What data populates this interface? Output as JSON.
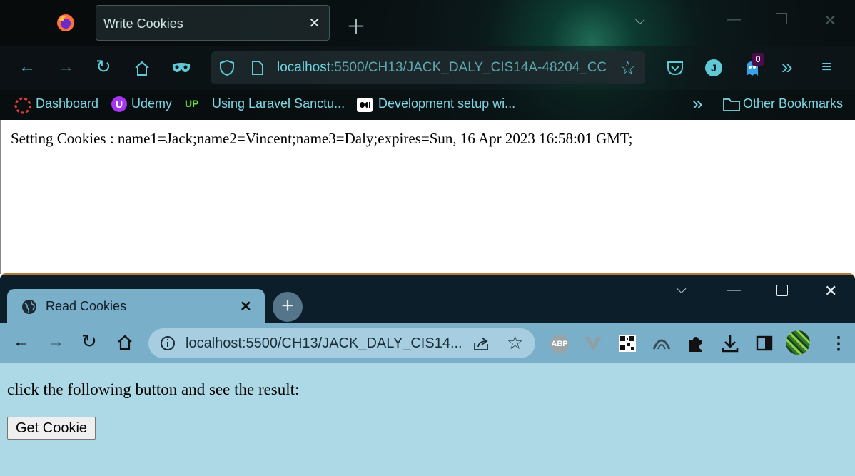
{
  "firefox": {
    "tab": {
      "title": "Write Cookies"
    },
    "url": {
      "host": "localhost",
      "path": ":5500/CH13/JACK_DALY_CIS14A-48204_CC"
    },
    "profile_initial": "J",
    "extension_badge": "0",
    "bookmarks": [
      {
        "label": "Dashboard"
      },
      {
        "label": "Udemy"
      },
      {
        "label": "UP_"
      },
      {
        "label": "Using Laravel Sanctu..."
      },
      {
        "label": "Development setup wi..."
      },
      {
        "label": "Other Bookmarks"
      }
    ],
    "content_text": "Setting Cookies : name1=Jack;name2=Vincent;name3=Daly;expires=Sun, 16 Apr 2023 16:58:01 GMT;"
  },
  "chrome": {
    "tab": {
      "title": "Read Cookies"
    },
    "url": "localhost:5500/CH13/JACK_DALY_CIS14...",
    "extension_abp": "ABP",
    "content_text": "click the following button and see the result:",
    "button_label": "Get Cookie"
  },
  "colors": {
    "firefox_accent": "#5fc9d6",
    "chrome_tab": "#79afc8",
    "chrome_page_bg": "#add8e6"
  },
  "icons": {
    "firefox": [
      "firefox-logo-icon",
      "tab-close-icon",
      "new-tab-icon",
      "back-icon",
      "forward-icon",
      "reload-icon",
      "home-icon",
      "private-mask-icon",
      "shield-icon",
      "page-icon",
      "bookmark-star-icon",
      "pocket-icon",
      "account-icon",
      "extension-ghost-icon",
      "more-tools-icon",
      "hamburger-menu-icon",
      "folder-icon"
    ],
    "chrome": [
      "globe-icon",
      "tab-close-icon",
      "new-tab-icon",
      "minimize-icon",
      "maximize-icon",
      "close-icon",
      "back-icon",
      "forward-icon",
      "reload-icon",
      "home-icon",
      "info-icon",
      "share-icon",
      "star-icon",
      "adblock-icon",
      "vue-devtools-icon",
      "qr-code-icon",
      "extension-arc-icon",
      "puzzle-icon",
      "download-icon",
      "side-panel-icon",
      "avatar",
      "kebab-menu-icon"
    ]
  }
}
